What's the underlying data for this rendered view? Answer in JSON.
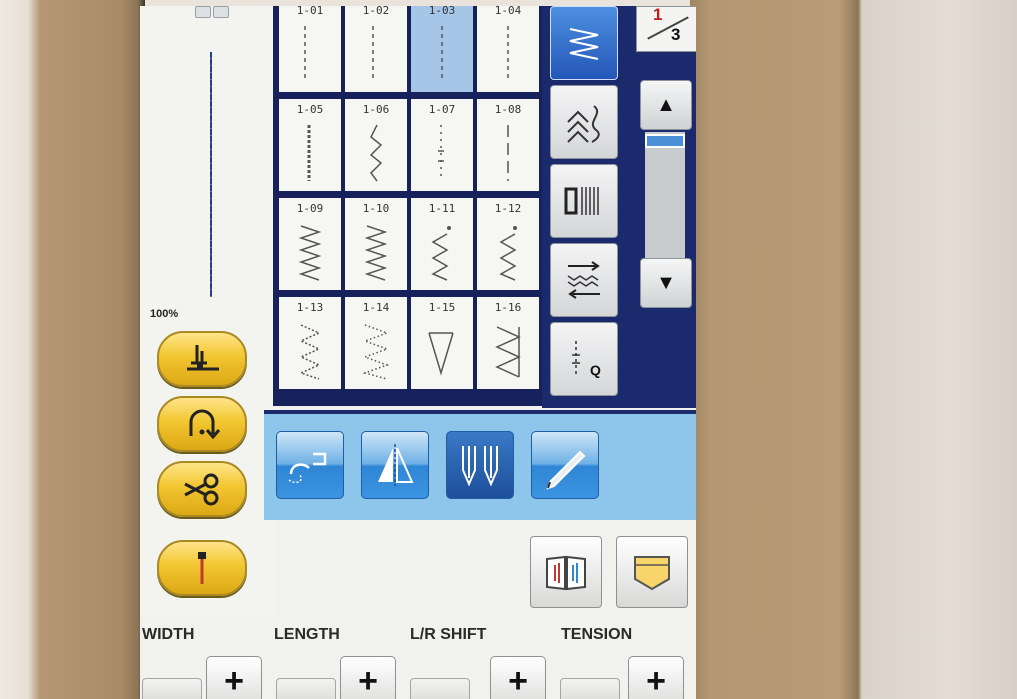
{
  "pattern_page": {
    "current": "1",
    "total": "3"
  },
  "zoom": "100%",
  "stitch_grid": [
    {
      "label": "1-01",
      "icon": "straight-stitch-left-icon",
      "selected": false
    },
    {
      "label": "1-02",
      "icon": "straight-stitch-left-icon",
      "selected": false
    },
    {
      "label": "1-03",
      "icon": "straight-stitch-middle-icon",
      "selected": true
    },
    {
      "label": "1-04",
      "icon": "straight-stitch-middle-icon",
      "selected": false
    },
    {
      "label": "1-05",
      "icon": "triple-stretch-stitch-icon",
      "selected": false
    },
    {
      "label": "1-06",
      "icon": "stem-stitch-icon",
      "selected": false
    },
    {
      "label": "1-07",
      "icon": "decorative-stitch-icon",
      "selected": false
    },
    {
      "label": "1-08",
      "icon": "basting-stitch-icon",
      "selected": false
    },
    {
      "label": "1-09",
      "icon": "zigzag-stitch-icon",
      "selected": false
    },
    {
      "label": "1-10",
      "icon": "zigzag-stitch-icon",
      "selected": false
    },
    {
      "label": "1-11",
      "icon": "zigzag-right-stitch-icon",
      "selected": false
    },
    {
      "label": "1-12",
      "icon": "zigzag-left-stitch-icon",
      "selected": false
    },
    {
      "label": "1-13",
      "icon": "two-step-elastic-zigzag-icon",
      "selected": false
    },
    {
      "label": "1-14",
      "icon": "three-step-elastic-zigzag-icon",
      "selected": false
    },
    {
      "label": "1-15",
      "icon": "overcasting-stitch-icon",
      "selected": false
    },
    {
      "label": "1-16",
      "icon": "overcasting-stitch-icon",
      "selected": false
    }
  ],
  "categories": [
    {
      "icon": "utility-stitch-category-icon",
      "active": true
    },
    {
      "icon": "decorative-stitch-category-icon",
      "active": false
    },
    {
      "icon": "buttonhole-category-icon",
      "active": false
    },
    {
      "icon": "satin-stitch-category-icon",
      "active": false
    },
    {
      "icon": "quilting-stitch-category-icon",
      "active": false,
      "text": "Q"
    }
  ],
  "left_buttons": [
    {
      "icon": "presser-foot-lifter-icon"
    },
    {
      "icon": "reverse-stitch-icon"
    },
    {
      "icon": "thread-cutter-icon"
    },
    {
      "icon": "needle-position-icon"
    }
  ],
  "function_keys": [
    {
      "icon": "free-motion-mode-icon",
      "active": false
    },
    {
      "icon": "mirror-image-icon",
      "active": false
    },
    {
      "icon": "twin-needle-icon",
      "active": true
    },
    {
      "icon": "edit-pen-icon",
      "active": false
    }
  ],
  "tool_keys": [
    {
      "icon": "manual-book-icon"
    },
    {
      "icon": "pocket-memory-icon"
    }
  ],
  "controls": [
    {
      "label": "WIDTH"
    },
    {
      "label": "LENGTH"
    },
    {
      "label": "L/R SHIFT"
    },
    {
      "label": "TENSION"
    }
  ],
  "plus_symbol": "+",
  "scroll_up_symbol": "▲",
  "scroll_down_symbol": "▼",
  "colors": {
    "accent_blue": "#2f86d6",
    "frame_navy": "#1b2a6c",
    "yellow_key": "#f2c630",
    "page_red": "#c21e1e"
  }
}
